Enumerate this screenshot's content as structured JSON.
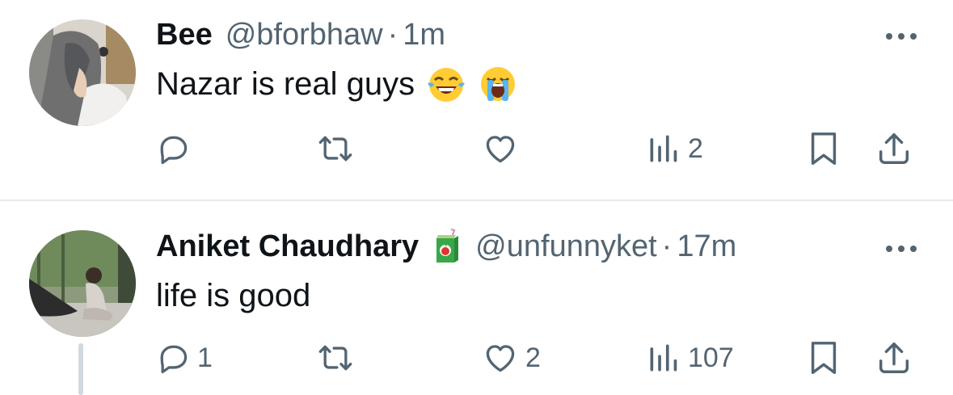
{
  "tweets": [
    {
      "display_name": "Bee",
      "handle": "@bforbhaw",
      "separator": "·",
      "time": "1m",
      "text": "Nazar is real guys",
      "emojis": [
        "face-with-tears-of-joy-emoji",
        "loudly-crying-face-emoji"
      ],
      "counts": {
        "reply": "",
        "retweet": "",
        "like": "",
        "views": "2"
      },
      "has_badge": false
    },
    {
      "display_name": "Aniket Chaudhary",
      "handle": "@unfunnyket",
      "separator": "·",
      "time": "17m",
      "text": "life is good",
      "emojis": [],
      "badge": "juice-box-emoji",
      "counts": {
        "reply": "1",
        "retweet": "",
        "like": "2",
        "views": "107"
      },
      "has_badge": true,
      "thread_continues": true
    }
  ],
  "icons": {
    "reply": "reply-icon",
    "retweet": "retweet-icon",
    "like": "heart-icon",
    "views": "views-icon",
    "bookmark": "bookmark-icon",
    "share": "share-icon",
    "more": "more-icon"
  },
  "colors": {
    "text": "#0f1419",
    "secondary": "#536471",
    "divider": "#e7e9ea"
  }
}
